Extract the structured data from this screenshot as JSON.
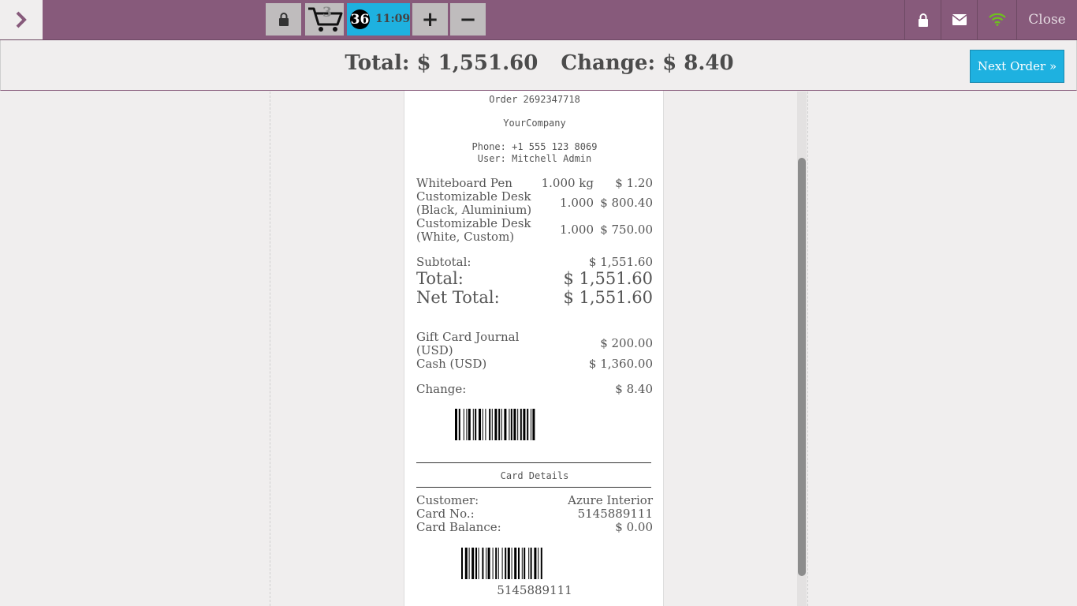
{
  "header": {
    "cart_count": "3",
    "order_number": "36",
    "order_time": "11:09",
    "plus_label": "+",
    "minus_label": "−",
    "close_label": "Close"
  },
  "totals": {
    "total_text": "Total: $ 1,551.60",
    "change_text": "Change: $ 8.40",
    "next_order_label": "Next Order »"
  },
  "receipt": {
    "order_ref": "Order 2692347718",
    "company": "YourCompany",
    "phone": "Phone: +1 555 123 8069",
    "user": "User: Mitchell Admin",
    "lines": [
      {
        "name": "Whiteboard Pen",
        "qty": "1.000 kg",
        "price": "$ 1.20"
      },
      {
        "name": "Customizable Desk\n(Black, Aluminium)",
        "qty": "1.000",
        "price": "$ 800.40"
      },
      {
        "name": "Customizable Desk\n(White, Custom)",
        "qty": "1.000",
        "price": "$ 750.00"
      }
    ],
    "subtotal_label": "Subtotal:",
    "subtotal_value": "$ 1,551.60",
    "total_label": "Total:",
    "total_value": "$ 1,551.60",
    "net_total_label": "Net Total:",
    "net_total_value": "$ 1,551.60",
    "payments": [
      {
        "name": "Gift Card Journal\n(USD)",
        "amount": "$ 200.00"
      },
      {
        "name": "Cash (USD)",
        "amount": "$ 1,360.00"
      }
    ],
    "change_label": "Change:",
    "change_value": "$ 8.40",
    "card_details_title": "Card Details",
    "customer_label": "Customer:",
    "customer_value": "Azure Interior",
    "card_no_label": "Card No.:",
    "card_no_value": "5145889111",
    "card_balance_label": "Card Balance:",
    "card_balance_value": "$ 0.00",
    "card_barcode_text": "5145889111"
  },
  "colors": {
    "topbar": "#875a7b",
    "accent": "#1eb1e0",
    "wifi": "#6ec01e"
  }
}
